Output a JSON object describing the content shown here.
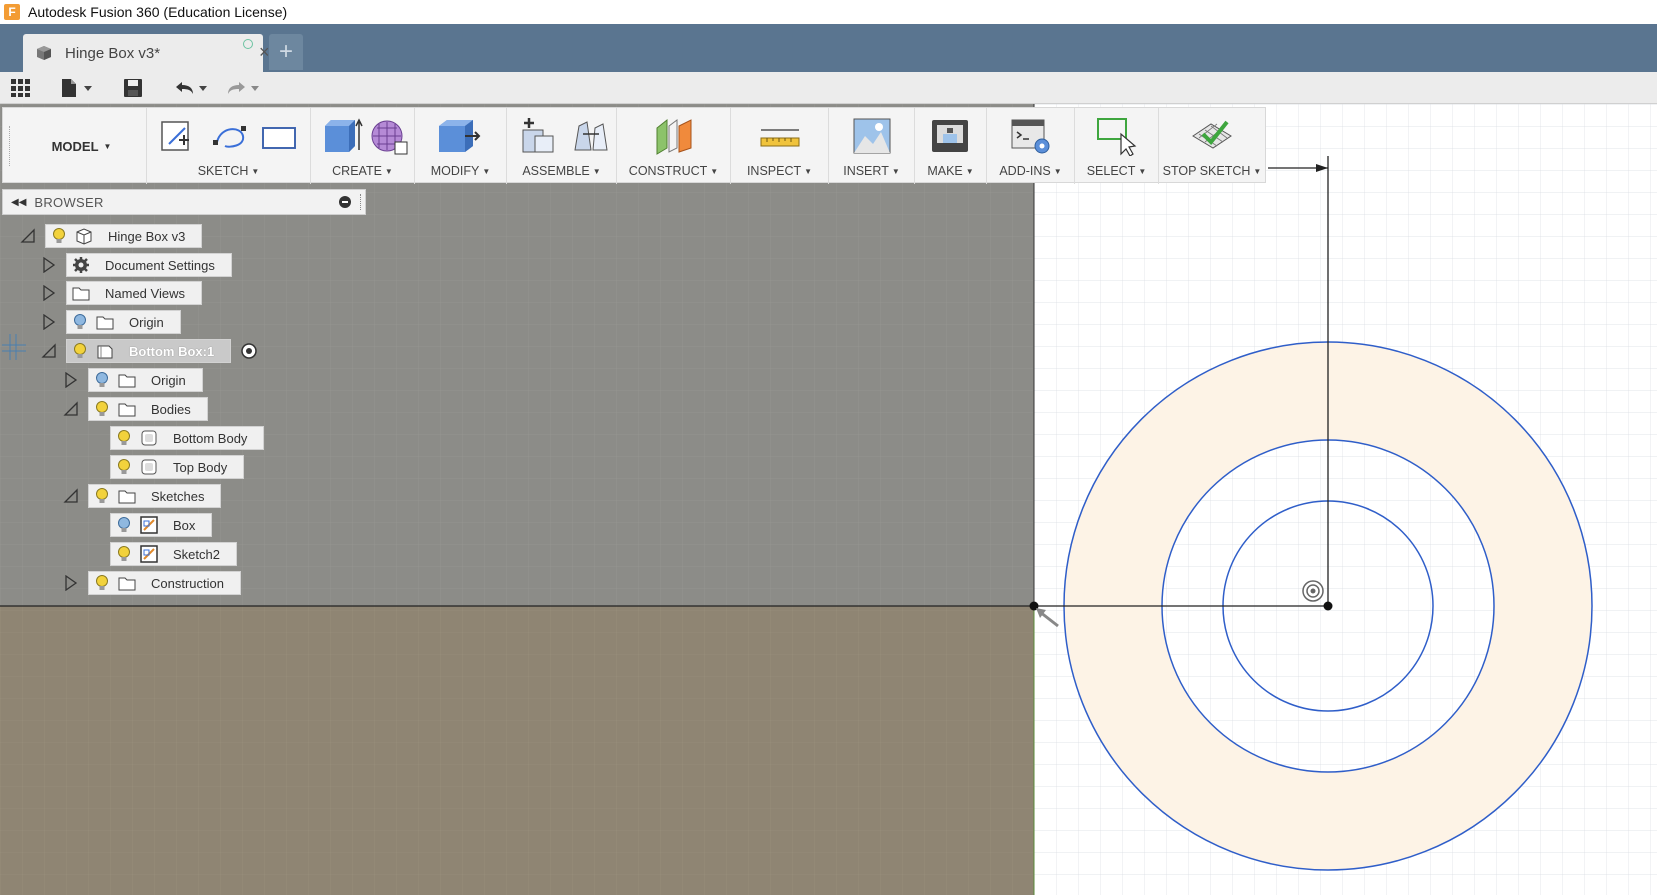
{
  "window": {
    "title": "Autodesk Fusion 360 (Education License)",
    "logo_letter": "F"
  },
  "tabs": {
    "document_title": "Hinge Box v3*",
    "new_tab_label": "+"
  },
  "ribbon": {
    "workspace": "MODEL",
    "groups": [
      {
        "label": "SKETCH"
      },
      {
        "label": "CREATE"
      },
      {
        "label": "MODIFY"
      },
      {
        "label": "ASSEMBLE"
      },
      {
        "label": "CONSTRUCT"
      },
      {
        "label": "INSPECT"
      },
      {
        "label": "INSERT"
      },
      {
        "label": "MAKE"
      },
      {
        "label": "ADD-INS"
      },
      {
        "label": "SELECT"
      },
      {
        "label": "STOP SKETCH"
      }
    ]
  },
  "browser": {
    "title": "BROWSER",
    "tree": [
      {
        "label": "Hinge Box v3",
        "icon": "component-icon",
        "expanded": true,
        "selected": false
      },
      {
        "label": "Document Settings",
        "icon": "gear-icon",
        "expanded": false,
        "selected": false
      },
      {
        "label": "Named Views",
        "icon": "folder-icon",
        "expanded": false,
        "selected": false
      },
      {
        "label": "Origin",
        "icon": "folder-icon",
        "expanded": false,
        "selected": false
      },
      {
        "label": "Bottom Box:1",
        "icon": "component-icon",
        "expanded": true,
        "selected": true
      },
      {
        "label": "Origin",
        "icon": "folder-icon",
        "expanded": false,
        "selected": false
      },
      {
        "label": "Bodies",
        "icon": "folder-icon",
        "expanded": true,
        "selected": false
      },
      {
        "label": "Bottom Body",
        "icon": "body-icon",
        "expanded": false,
        "selected": false
      },
      {
        "label": "Top Body",
        "icon": "body-icon",
        "expanded": false,
        "selected": false
      },
      {
        "label": "Sketches",
        "icon": "folder-icon",
        "expanded": true,
        "selected": false
      },
      {
        "label": "Box",
        "icon": "sketch-icon",
        "expanded": false,
        "selected": false
      },
      {
        "label": "Sketch2",
        "icon": "sketch-icon",
        "expanded": false,
        "selected": false
      },
      {
        "label": "Construction",
        "icon": "folder-icon",
        "expanded": false,
        "selected": false
      }
    ]
  },
  "colors": {
    "tabbar": "#5a7590",
    "viewport_upper": "#8c8c88",
    "viewport_lower": "#8f8573",
    "sketch_grid_bg": "#ffffff",
    "profile_fill": "#fdf3e6",
    "sketch_curve": "#2f5ec9",
    "bulb_on": "#f2d23c",
    "bulb_off": "#8fb8e0"
  }
}
